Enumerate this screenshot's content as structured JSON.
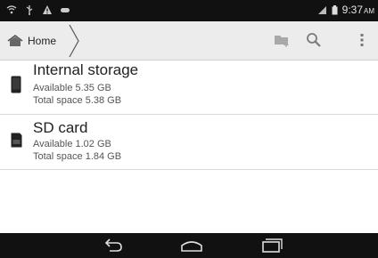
{
  "status_bar": {
    "time": "9:37",
    "ampm": "AM",
    "left_icons": [
      "wifi-icon",
      "usb-icon",
      "warning-icon",
      "gamepad-icon"
    ],
    "right_icons": [
      "signal-icon",
      "battery-icon"
    ]
  },
  "action_bar": {
    "breadcrumb_label": "Home",
    "icons": [
      "new-folder-icon",
      "search-icon",
      "overflow-menu-icon"
    ]
  },
  "storage": [
    {
      "name": "Internal storage",
      "available": "Available 5.35 GB",
      "total": "Total space 5.38 GB",
      "icon": "phone-icon"
    },
    {
      "name": "SD card",
      "available": "Available 1.02 GB",
      "total": "Total space 1.84 GB",
      "icon": "sd-card-icon"
    }
  ],
  "nav_bar": {
    "buttons": [
      "back-icon",
      "home-icon",
      "recent-apps-icon"
    ]
  },
  "colors": {
    "status_bar": "#111111",
    "action_bar": "#ececec",
    "nav_bar": "#111111"
  }
}
